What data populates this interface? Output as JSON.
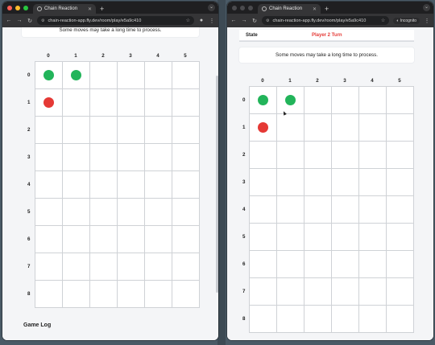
{
  "browser": {
    "tab_title": "Chain Reaction",
    "new_tab": "+",
    "url": "chain-reaction-app.fly.dev/room/play/e5a9c410",
    "incognito_label": "Incognito"
  },
  "game": {
    "state_key": "State",
    "state_value": "Player 2 Turn",
    "notice": "Some moves may take a long time to process.",
    "columns": [
      "0",
      "1",
      "2",
      "3",
      "4",
      "5"
    ],
    "rows": [
      "0",
      "1",
      "2",
      "3",
      "4",
      "5",
      "6",
      "7",
      "8"
    ],
    "orbs": [
      {
        "row": 0,
        "col": 0,
        "color": "green"
      },
      {
        "row": 0,
        "col": 1,
        "color": "green"
      },
      {
        "row": 1,
        "col": 0,
        "color": "red"
      }
    ],
    "game_log_title": "Game Log"
  },
  "colors": {
    "player_green": "#22b45a",
    "player_red": "#e53935",
    "turn_text": "#e53935"
  }
}
